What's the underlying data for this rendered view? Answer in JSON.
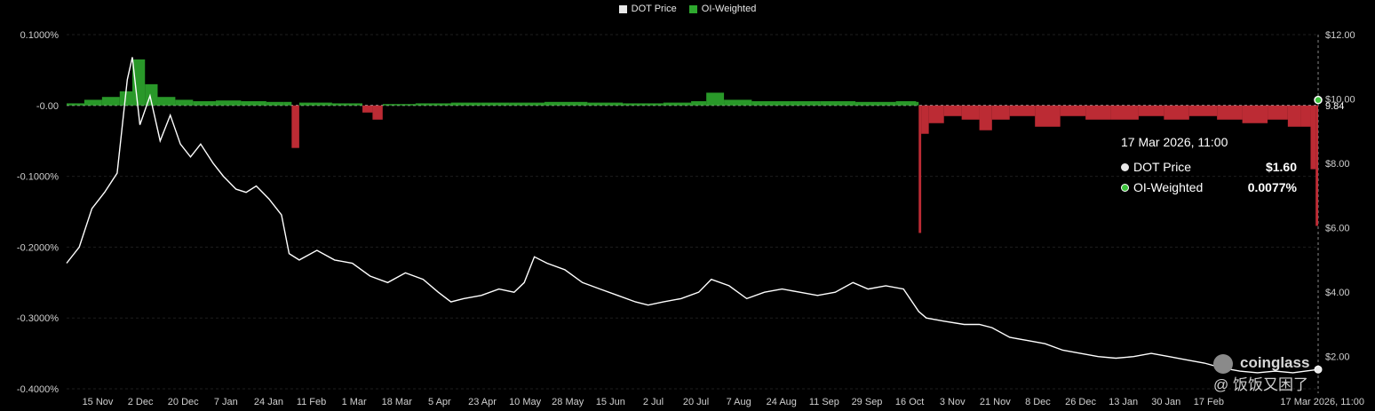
{
  "legend": [
    {
      "label": "DOT Price",
      "color": "#e8e8e8"
    },
    {
      "label": "OI-Weighted",
      "color": "#2ea82e"
    }
  ],
  "tooltip": {
    "time": "17 Mar 2026, 11:00",
    "rows": [
      {
        "name": "DOT Price",
        "value": "$1.60",
        "color": "#e8e8e8"
      },
      {
        "name": "OI-Weighted",
        "value": "0.0077%",
        "color": "#3cc23c"
      }
    ]
  },
  "watermark": {
    "brand": "coinglass",
    "sub": "@ 饭饭又困了"
  },
  "colors": {
    "positive": "#2ea82e",
    "negative": "#d0303a",
    "price_line": "#ffffff",
    "grid": "#1e1e1e"
  },
  "chart_data": {
    "type": "line",
    "left_axis": {
      "ticks": [
        "0.1000%",
        "-0.00",
        "-0.1000%",
        "-0.2000%",
        "-0.3000%",
        "-0.4000%"
      ],
      "ylim": [
        -0.4,
        0.1
      ]
    },
    "right_axis": {
      "ticks": [
        "$12.00",
        "$10.00",
        "$8.00",
        "$6.00",
        "$4.00",
        "$2.00"
      ],
      "ylim": [
        1.0,
        12.0
      ],
      "current_label": "9.84"
    },
    "x_ticks": [
      "15 Nov",
      "2 Dec",
      "20 Dec",
      "7 Jan",
      "24 Jan",
      "11 Feb",
      "1 Mar",
      "18 Mar",
      "5 Apr",
      "23 Apr",
      "10 May",
      "28 May",
      "15 Jun",
      "2 Jul",
      "20 Jul",
      "7 Aug",
      "24 Aug",
      "11 Sep",
      "29 Sep",
      "16 Oct",
      "3 Nov",
      "21 Nov",
      "8 Dec",
      "26 Dec",
      "13 Jan",
      "30 Jan",
      "17 Feb",
      "17 Mar 2026, 11:00"
    ],
    "x_range": [
      "2024-11-07",
      "2026-03-17"
    ],
    "series": [
      {
        "name": "DOT Price",
        "axis": "right",
        "points": [
          [
            "2024-11-07",
            4.9
          ],
          [
            "2024-11-12",
            5.4
          ],
          [
            "2024-11-17",
            6.6
          ],
          [
            "2024-11-22",
            7.1
          ],
          [
            "2024-11-27",
            7.7
          ],
          [
            "2024-12-01",
            10.6
          ],
          [
            "2024-12-03",
            11.3
          ],
          [
            "2024-12-06",
            9.2
          ],
          [
            "2024-12-10",
            10.1
          ],
          [
            "2024-12-14",
            8.7
          ],
          [
            "2024-12-18",
            9.5
          ],
          [
            "2024-12-22",
            8.6
          ],
          [
            "2024-12-26",
            8.2
          ],
          [
            "2024-12-30",
            8.6
          ],
          [
            "2025-01-04",
            8.0
          ],
          [
            "2025-01-08",
            7.6
          ],
          [
            "2025-01-13",
            7.2
          ],
          [
            "2025-01-17",
            7.1
          ],
          [
            "2025-01-21",
            7.3
          ],
          [
            "2025-01-26",
            6.9
          ],
          [
            "2025-01-31",
            6.4
          ],
          [
            "2025-02-03",
            5.2
          ],
          [
            "2025-02-07",
            5.0
          ],
          [
            "2025-02-14",
            5.3
          ],
          [
            "2025-02-21",
            5.0
          ],
          [
            "2025-02-28",
            4.9
          ],
          [
            "2025-03-07",
            4.5
          ],
          [
            "2025-03-14",
            4.3
          ],
          [
            "2025-03-21",
            4.6
          ],
          [
            "2025-03-28",
            4.4
          ],
          [
            "2025-04-03",
            4.0
          ],
          [
            "2025-04-08",
            3.7
          ],
          [
            "2025-04-13",
            3.8
          ],
          [
            "2025-04-20",
            3.9
          ],
          [
            "2025-04-27",
            4.1
          ],
          [
            "2025-05-03",
            4.0
          ],
          [
            "2025-05-07",
            4.3
          ],
          [
            "2025-05-11",
            5.1
          ],
          [
            "2025-05-16",
            4.9
          ],
          [
            "2025-05-23",
            4.7
          ],
          [
            "2025-05-30",
            4.3
          ],
          [
            "2025-06-06",
            4.1
          ],
          [
            "2025-06-13",
            3.9
          ],
          [
            "2025-06-20",
            3.7
          ],
          [
            "2025-06-25",
            3.6
          ],
          [
            "2025-07-01",
            3.7
          ],
          [
            "2025-07-08",
            3.8
          ],
          [
            "2025-07-15",
            4.0
          ],
          [
            "2025-07-20",
            4.4
          ],
          [
            "2025-07-27",
            4.2
          ],
          [
            "2025-08-03",
            3.8
          ],
          [
            "2025-08-10",
            4.0
          ],
          [
            "2025-08-17",
            4.1
          ],
          [
            "2025-08-24",
            4.0
          ],
          [
            "2025-08-31",
            3.9
          ],
          [
            "2025-09-07",
            4.0
          ],
          [
            "2025-09-14",
            4.3
          ],
          [
            "2025-09-20",
            4.1
          ],
          [
            "2025-09-27",
            4.2
          ],
          [
            "2025-10-04",
            4.1
          ],
          [
            "2025-10-10",
            3.4
          ],
          [
            "2025-10-13",
            3.2
          ],
          [
            "2025-10-20",
            3.1
          ],
          [
            "2025-10-28",
            3.0
          ],
          [
            "2025-11-03",
            3.0
          ],
          [
            "2025-11-08",
            2.9
          ],
          [
            "2025-11-15",
            2.6
          ],
          [
            "2025-11-22",
            2.5
          ],
          [
            "2025-11-29",
            2.4
          ],
          [
            "2025-12-06",
            2.2
          ],
          [
            "2025-12-13",
            2.1
          ],
          [
            "2025-12-20",
            2.0
          ],
          [
            "2025-12-27",
            1.95
          ],
          [
            "2026-01-03",
            2.0
          ],
          [
            "2026-01-10",
            2.1
          ],
          [
            "2026-01-17",
            2.0
          ],
          [
            "2026-01-24",
            1.9
          ],
          [
            "2026-01-31",
            1.8
          ],
          [
            "2026-02-07",
            1.65
          ],
          [
            "2026-02-14",
            1.55
          ],
          [
            "2026-02-21",
            1.5
          ],
          [
            "2026-02-28",
            1.55
          ],
          [
            "2026-03-07",
            1.5
          ],
          [
            "2026-03-17",
            1.6
          ]
        ]
      },
      {
        "name": "OI-Weighted",
        "axis": "left",
        "type": "area",
        "points": [
          [
            "2024-11-07",
            0.003
          ],
          [
            "2024-11-14",
            0.008
          ],
          [
            "2024-11-21",
            0.012
          ],
          [
            "2024-11-28",
            0.02
          ],
          [
            "2024-12-03",
            0.065
          ],
          [
            "2024-12-08",
            0.03
          ],
          [
            "2024-12-13",
            0.012
          ],
          [
            "2024-12-20",
            0.008
          ],
          [
            "2024-12-27",
            0.006
          ],
          [
            "2025-01-05",
            0.007
          ],
          [
            "2025-01-15",
            0.006
          ],
          [
            "2025-01-25",
            0.005
          ],
          [
            "2025-02-01",
            0.005
          ],
          [
            "2025-02-04",
            -0.06
          ],
          [
            "2025-02-07",
            0.004
          ],
          [
            "2025-02-20",
            0.003
          ],
          [
            "2025-03-01",
            0.003
          ],
          [
            "2025-03-04",
            -0.01
          ],
          [
            "2025-03-08",
            -0.02
          ],
          [
            "2025-03-12",
            0.002
          ],
          [
            "2025-03-25",
            0.003
          ],
          [
            "2025-04-08",
            0.004
          ],
          [
            "2025-04-20",
            0.004
          ],
          [
            "2025-05-01",
            0.004
          ],
          [
            "2025-05-15",
            0.005
          ],
          [
            "2025-06-01",
            0.004
          ],
          [
            "2025-06-15",
            0.003
          ],
          [
            "2025-07-01",
            0.004
          ],
          [
            "2025-07-12",
            0.006
          ],
          [
            "2025-07-18",
            0.018
          ],
          [
            "2025-07-25",
            0.008
          ],
          [
            "2025-08-05",
            0.006
          ],
          [
            "2025-08-20",
            0.006
          ],
          [
            "2025-09-01",
            0.006
          ],
          [
            "2025-09-15",
            0.005
          ],
          [
            "2025-10-01",
            0.006
          ],
          [
            "2025-10-09",
            0.005
          ],
          [
            "2025-10-10",
            -0.18
          ],
          [
            "2025-10-11",
            -0.04
          ],
          [
            "2025-10-14",
            -0.025
          ],
          [
            "2025-10-20",
            -0.015
          ],
          [
            "2025-10-27",
            -0.02
          ],
          [
            "2025-11-03",
            -0.035
          ],
          [
            "2025-11-08",
            -0.02
          ],
          [
            "2025-11-15",
            -0.015
          ],
          [
            "2025-11-25",
            -0.03
          ],
          [
            "2025-12-05",
            -0.015
          ],
          [
            "2025-12-15",
            -0.02
          ],
          [
            "2025-12-25",
            -0.02
          ],
          [
            "2026-01-05",
            -0.015
          ],
          [
            "2026-01-15",
            -0.02
          ],
          [
            "2026-01-25",
            -0.015
          ],
          [
            "2026-02-05",
            -0.02
          ],
          [
            "2026-02-15",
            -0.025
          ],
          [
            "2026-02-25",
            -0.02
          ],
          [
            "2026-03-05",
            -0.03
          ],
          [
            "2026-03-10",
            -0.03
          ],
          [
            "2026-03-14",
            -0.09
          ],
          [
            "2026-03-16",
            -0.17
          ],
          [
            "2026-03-17",
            0.0077
          ]
        ]
      }
    ]
  }
}
